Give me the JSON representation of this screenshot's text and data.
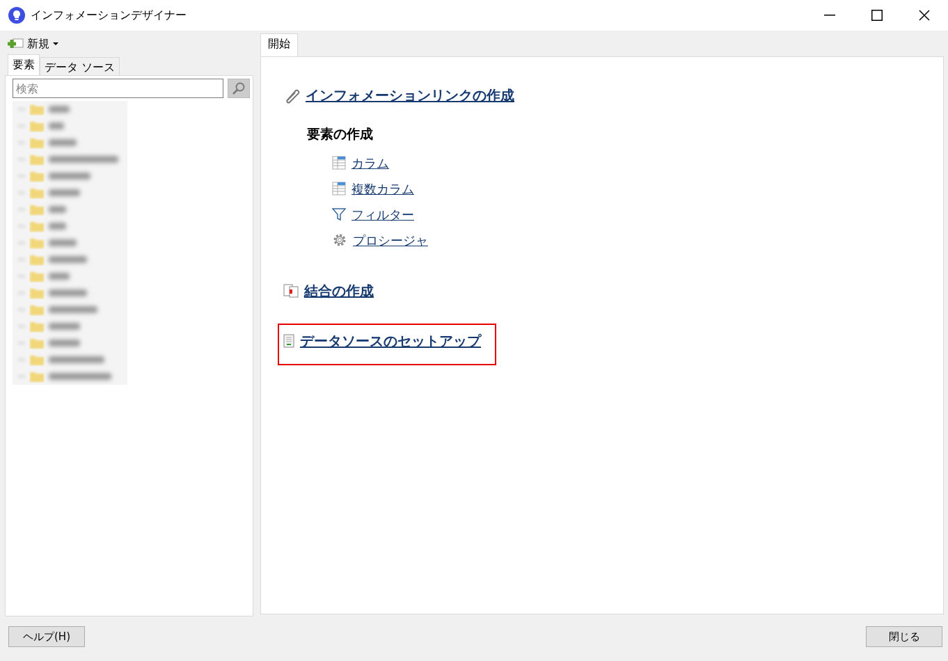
{
  "window": {
    "title": "インフォメーションデザイナー"
  },
  "toolbar": {
    "new_button": "新規"
  },
  "left_tabs": [
    {
      "label": "要素",
      "selected": true
    },
    {
      "label": "データ ソース",
      "selected": false
    }
  ],
  "search": {
    "placeholder": "検索"
  },
  "tree_items": [
    {
      "kind": "folder"
    },
    {
      "kind": "folder"
    },
    {
      "kind": "folder"
    },
    {
      "kind": "folder"
    },
    {
      "kind": "folder"
    },
    {
      "kind": "folder"
    },
    {
      "kind": "folder"
    },
    {
      "kind": "folder"
    },
    {
      "kind": "folder"
    },
    {
      "kind": "folder"
    },
    {
      "kind": "folder"
    },
    {
      "kind": "folder"
    },
    {
      "kind": "folder"
    },
    {
      "kind": "folder"
    },
    {
      "kind": "folder"
    },
    {
      "kind": "folder"
    },
    {
      "kind": "folder"
    }
  ],
  "main_tabs": [
    {
      "label": "開始",
      "selected": true
    }
  ],
  "start_page": [
    {
      "kind": "link",
      "label": "インフォメーションリンクの作成",
      "highlighted": false
    },
    {
      "kind": "heading",
      "label": "要素の作成"
    },
    {
      "kind": "sublink",
      "label": "カラム"
    },
    {
      "kind": "sublink",
      "label": "複数カラム"
    },
    {
      "kind": "sublink",
      "label": "フィルター"
    },
    {
      "kind": "sublink",
      "label": "プロシージャ"
    },
    {
      "kind": "link",
      "label": "結合の作成",
      "highlighted": false
    },
    {
      "kind": "link",
      "label": "データソースのセットアップ",
      "highlighted": true
    }
  ],
  "footer": {
    "help_button": "ヘルプ(H)",
    "close_button": "閉じる"
  }
}
